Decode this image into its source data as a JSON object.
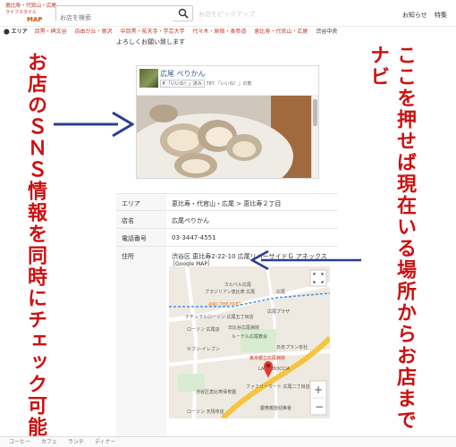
{
  "header": {
    "logo_line1": "恵比寿・代官山・広尾",
    "logo_line2": "ライフスタイル",
    "logo_line3": "MAP",
    "search_placeholder": "お店を検索",
    "faint_text": "お店をピックアップ",
    "nav": [
      "お知らせ",
      "特集"
    ]
  },
  "area_bar": {
    "label": "エリア",
    "items": [
      "目黒・碑文谷",
      "自由が丘・奥沢",
      "中目黒・祐天寺・学芸大学",
      "代々木・原宿・表参道",
      "恵比寿・代官山・広尾",
      "渋谷中央"
    ]
  },
  "greeting": "よろしくお願い致します",
  "facebook": {
    "page_name": "広尾 ぺりかん",
    "like_button": "「いいね！」済み",
    "like_count": "787 「いいね！」の数"
  },
  "info": {
    "rows": [
      {
        "key": "エリア",
        "value": "恵比寿・代官山・広尾 > 恵比寿２丁目"
      },
      {
        "key": "店名",
        "value": "広尾ぺりかん"
      },
      {
        "key": "電話番号",
        "value": "03-3447-4551"
      },
      {
        "key": "住所",
        "value": "渋谷区 恵比寿2-22-10 広尾リバーサイドＧ アネックス"
      }
    ],
    "map_link": "［Google MAP］"
  },
  "map": {
    "address": "渋谷区 恵比寿2-22-10 広尾リバーサイドＧ アネックス",
    "labels": {
      "karuvina": "カルベル広尾",
      "brasserie": "ブラジリアン恵比寿 広尾",
      "hiroo_st": "広尾",
      "uofret": "AND THE FRET",
      "clinic": "ナチュラルローソン 広尾五丁目店",
      "lawson": "ローソン 広尾店",
      "hiroo_plaza": "広尾プラザ",
      "frontier": "日比谷広尾病院",
      "church": "ルーテル広尾教会",
      "eleven": "セブン-イレブン",
      "metro": "東京都立広尾病院",
      "bridge": "日赤プラン本社",
      "labo": "LA BISBOCCIA",
      "shibuya_high": "渋谷区恵比寿保育園",
      "familymart": "ファミリーマート 広尾二丁目店",
      "lawson2": "ローソン 天現寺店",
      "keio": "慶應義塾幼稚舎"
    },
    "road_color": "#f5c542",
    "water_color": "#a3c8f0",
    "pin_color": "#e03b2f"
  },
  "annotations": {
    "left_text": "お店のＳＮＳ情報を同時にチェック可能",
    "right_text": "ここを押せば現在いる場所からお店までナビ",
    "arrow_color": "#2b3f8f",
    "text_color": "#cc1111"
  },
  "footer": {
    "items": [
      "コーヒー",
      "カフェ",
      "ランチ",
      "ディナー"
    ]
  }
}
